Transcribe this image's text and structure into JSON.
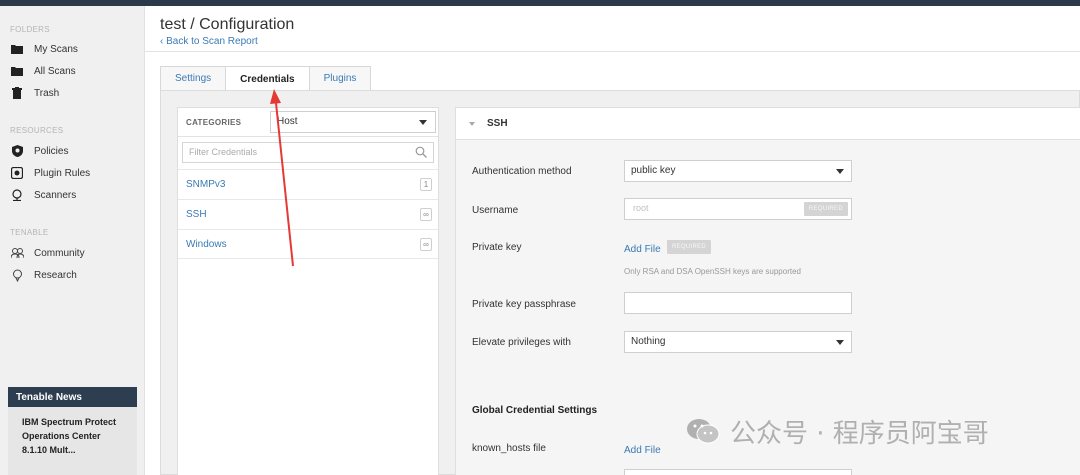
{
  "sidebar": {
    "folders_label": "FOLDERS",
    "folders": [
      {
        "label": "My Scans",
        "icon": "folder-icon"
      },
      {
        "label": "All Scans",
        "icon": "folder-icon"
      },
      {
        "label": "Trash",
        "icon": "trash-icon"
      }
    ],
    "resources_label": "RESOURCES",
    "resources": [
      {
        "label": "Policies",
        "icon": "shield-icon"
      },
      {
        "label": "Plugin Rules",
        "icon": "plugin-icon"
      },
      {
        "label": "Scanners",
        "icon": "scanner-icon"
      }
    ],
    "tenable_label": "TENABLE",
    "tenable": [
      {
        "label": "Community",
        "icon": "community-icon"
      },
      {
        "label": "Research",
        "icon": "research-icon"
      }
    ],
    "news": {
      "title": "Tenable News",
      "line1": "IBM Spectrum Protect",
      "line2": "Operations Center",
      "line3": "8.1.10 Mult..."
    }
  },
  "header": {
    "title": "test / Configuration",
    "back_link": "‹ Back to Scan Report"
  },
  "tabs": [
    {
      "label": "Settings",
      "active": false
    },
    {
      "label": "Credentials",
      "active": true
    },
    {
      "label": "Plugins",
      "active": false
    }
  ],
  "credentials": {
    "categories_label": "CATEGORIES",
    "category_value": "Host",
    "filter_placeholder": "Filter Credentials",
    "items": [
      {
        "label": "SNMPv3",
        "badge": "1"
      },
      {
        "label": "SSH",
        "badge": "∞"
      },
      {
        "label": "Windows",
        "badge": "∞"
      }
    ]
  },
  "ssh": {
    "title": "SSH",
    "auth_method_label": "Authentication method",
    "auth_method_value": "public key",
    "username_label": "Username",
    "username_placeholder": "root",
    "required_tag": "REQUIRED",
    "private_key_label": "Private key",
    "add_file": "Add File",
    "private_key_hint": "Only RSA and DSA OpenSSH keys are supported",
    "passphrase_label": "Private key passphrase",
    "elevate_label": "Elevate privileges with",
    "elevate_value": "Nothing",
    "global_heading": "Global Credential Settings",
    "known_hosts_label": "known_hosts file",
    "known_hosts_link": "Add File"
  },
  "watermark": {
    "text": "公众号 · 程序员阿宝哥"
  },
  "colors": {
    "accent": "#3a7ab5",
    "topbar": "#2b3a4a",
    "annotation_arrow": "#e53935"
  }
}
